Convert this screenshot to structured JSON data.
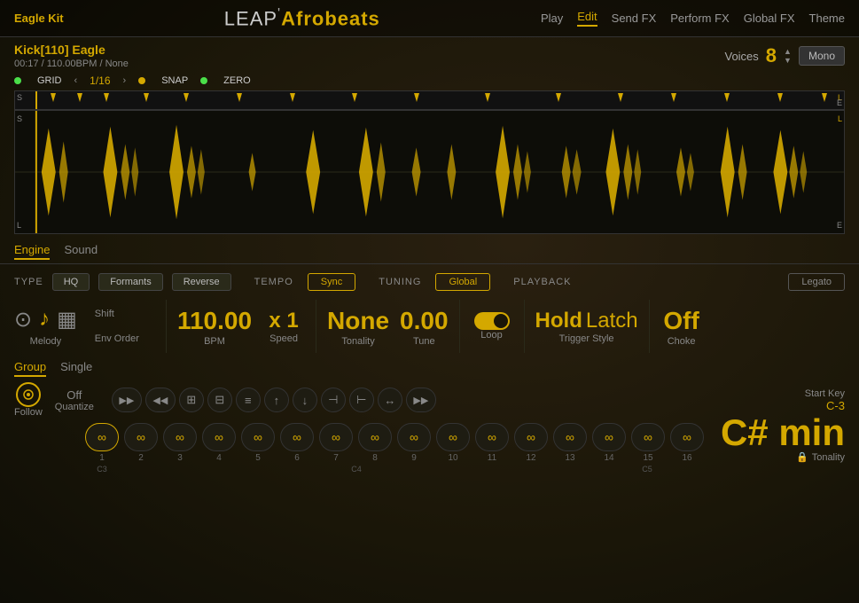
{
  "app": {
    "kit": "Eagle Kit",
    "leap_label": "LEAP",
    "apostrophe": "'",
    "preset_name": "Afrobeats"
  },
  "nav": {
    "items": [
      {
        "id": "play",
        "label": "Play",
        "active": false
      },
      {
        "id": "edit",
        "label": "Edit",
        "active": true
      },
      {
        "id": "send_fx",
        "label": "Send FX",
        "active": false
      },
      {
        "id": "perform_fx",
        "label": "Perform FX",
        "active": false
      },
      {
        "id": "global_fx",
        "label": "Global FX",
        "active": false
      },
      {
        "id": "theme",
        "label": "Theme",
        "active": false
      }
    ]
  },
  "sample": {
    "name": "Kick[110] Eagle",
    "time": "00:17",
    "bpm": "110.00BPM",
    "key": "None",
    "voices_label": "Voices",
    "voices_count": "8",
    "mono_label": "Mono"
  },
  "grid": {
    "grid_label": "GRID",
    "grid_value": "1/16",
    "snap_label": "SNAP",
    "zero_label": "ZERO"
  },
  "engine": {
    "tabs": [
      {
        "id": "engine",
        "label": "Engine",
        "active": true
      },
      {
        "id": "sound",
        "label": "Sound",
        "active": false
      }
    ],
    "type_label": "TYPE",
    "type_buttons": [
      {
        "id": "hq",
        "label": "HQ",
        "active": false
      },
      {
        "id": "formants",
        "label": "Formants",
        "active": false
      },
      {
        "id": "reverse",
        "label": "Reverse",
        "active": false
      }
    ],
    "tempo_label": "TEMPO",
    "tempo_sync": "Sync",
    "tuning_label": "TUNING",
    "tuning_global": "Global",
    "playback_label": "PLAYBACK",
    "legato": "Legato",
    "bpm_value": "110.00",
    "bpm_unit": "BPM",
    "speed_value": "x 1",
    "speed_label": "Speed",
    "tonality_value": "None",
    "tonality_label": "Tonality",
    "tune_value": "0.00",
    "tune_label": "Tune",
    "loop_label": "Loop",
    "trigger_hold": "Hold",
    "trigger_latch": "Latch",
    "trigger_label": "Trigger Style",
    "choke_value": "Off",
    "choke_label": "Choke"
  },
  "melody": {
    "icons": [
      "circle-target",
      "music-note",
      "grid"
    ],
    "label": "Melody",
    "shift_label": "Shift",
    "env_order_label": "Env Order"
  },
  "bottom": {
    "group_tabs": [
      {
        "id": "group",
        "label": "Group",
        "active": true
      },
      {
        "id": "single",
        "label": "Single",
        "active": false
      }
    ],
    "nav_buttons": [
      "<<",
      ">>",
      "grid-4",
      "grid-3",
      "bars",
      "down",
      "up",
      "collapse-left",
      "collapse-right",
      "nav-right"
    ],
    "follow": {
      "label": "Follow",
      "value": ""
    },
    "quantize": {
      "label": "Quantize",
      "value": "Off"
    },
    "steps": [
      {
        "num": "1",
        "note_label": "C3"
      },
      {
        "num": "2",
        "note_label": ""
      },
      {
        "num": "3",
        "note_label": ""
      },
      {
        "num": "4",
        "note_label": ""
      },
      {
        "num": "5",
        "note_label": ""
      },
      {
        "num": "6",
        "note_label": ""
      },
      {
        "num": "7",
        "note_label": ""
      },
      {
        "num": "8",
        "note_label": "C4"
      },
      {
        "num": "9",
        "note_label": ""
      },
      {
        "num": "10",
        "note_label": ""
      },
      {
        "num": "11",
        "note_label": ""
      },
      {
        "num": "12",
        "note_label": ""
      },
      {
        "num": "13",
        "note_label": ""
      },
      {
        "num": "14",
        "note_label": ""
      },
      {
        "num": "15",
        "note_label": ""
      },
      {
        "num": "16",
        "note_label": "C5"
      }
    ],
    "c_markers": [
      "C3",
      "",
      "",
      "",
      "",
      "",
      "",
      "C4",
      "",
      "",
      "",
      "",
      "",
      "",
      "",
      "C5"
    ],
    "start_key_label": "Start Key",
    "start_key_value": "C-3",
    "key_tonality_value": "C# min",
    "tonality_label": "Tonality",
    "lock_icon": "lock"
  }
}
